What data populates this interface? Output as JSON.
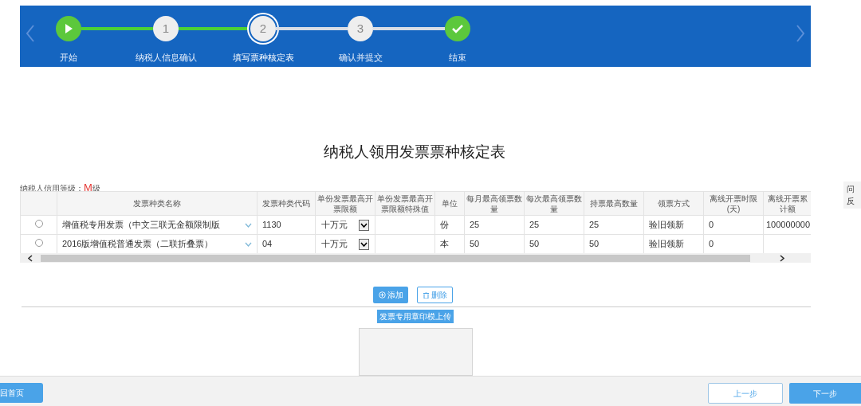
{
  "steps": [
    {
      "kind": "start",
      "label": "开始",
      "selected": false
    },
    {
      "kind": "number",
      "number": "1",
      "label": "纳税人信息确认",
      "selected": false
    },
    {
      "kind": "number",
      "number": "2",
      "label": "填写票种核定表",
      "selected": true
    },
    {
      "kind": "number",
      "number": "3",
      "label": "确认并提交",
      "selected": false
    },
    {
      "kind": "end",
      "label": "结束",
      "selected": false
    }
  ],
  "connectors": [
    {
      "done": true
    },
    {
      "done": true
    },
    {
      "done": false
    },
    {
      "done": false
    }
  ],
  "title": "纳税人领用发票票种核定表",
  "credit": {
    "label": "纳税人信用等级：",
    "grade": "M",
    "suffix": "级"
  },
  "table": {
    "columns": [
      "发票种类名称",
      "发票种类代码",
      "单份发票最高开票限额",
      "单份发票最高开票限额特殊值",
      "单位",
      "每月最高领票数量",
      "每次最高领票数量",
      "持票最高数量",
      "领票方式",
      "离线开票时限(天)",
      "离线开票累计额"
    ],
    "rows": [
      {
        "selected": false,
        "name": "增值税专用发票（中文三联无金额限制版",
        "code": "1130",
        "limit": "十万元",
        "special": "",
        "unit": "份",
        "monthly": "25",
        "each": "25",
        "hold": "25",
        "method": "验旧领新",
        "days": "0",
        "total": "100000000"
      },
      {
        "selected": false,
        "name": "2016版增值税普通发票（二联折叠票）",
        "code": "04",
        "limit": "十万元",
        "special": "",
        "unit": "本",
        "monthly": "50",
        "each": "50",
        "hold": "50",
        "method": "验旧领新",
        "days": "0",
        "total": ""
      }
    ]
  },
  "actions": [
    "添加",
    "删除"
  ],
  "upload_label": "发票专用章印模上传",
  "side_tab": [
    "问",
    "反"
  ],
  "footer": {
    "home": "回首页",
    "prev": "上一步",
    "next": "下一步"
  }
}
